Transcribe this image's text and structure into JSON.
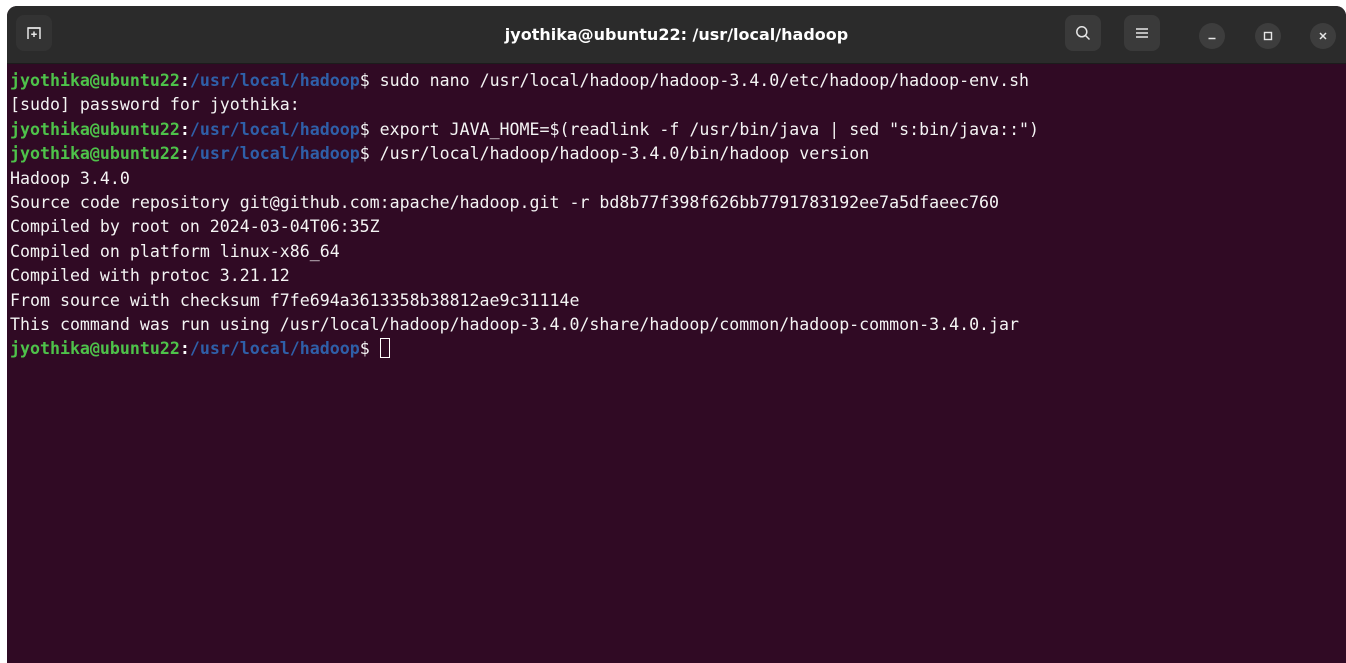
{
  "window": {
    "title": "jyothika@ubuntu22: /usr/local/hadoop"
  },
  "titlebar": {
    "new_tab_icon": "new-tab-icon",
    "search_icon": "search-icon",
    "menu_icon": "hamburger-menu-icon",
    "minimize_icon": "minimize-icon",
    "maximize_icon": "maximize-icon",
    "close_icon": "close-icon"
  },
  "prompt": {
    "user_host": "jyothika@ubuntu22",
    "separator": ":",
    "path": "/usr/local/hadoop",
    "dollar": "$"
  },
  "terminal": {
    "lines": [
      {
        "type": "prompt",
        "command": " sudo nano /usr/local/hadoop/hadoop-3.4.0/etc/hadoop/hadoop-env.sh"
      },
      {
        "type": "output",
        "text": "[sudo] password for jyothika:"
      },
      {
        "type": "prompt",
        "command": " export JAVA_HOME=$(readlink -f /usr/bin/java | sed \"s:bin/java::\")"
      },
      {
        "type": "prompt",
        "command": " /usr/local/hadoop/hadoop-3.4.0/bin/hadoop version"
      },
      {
        "type": "output",
        "text": "Hadoop 3.4.0"
      },
      {
        "type": "output",
        "text": "Source code repository git@github.com:apache/hadoop.git -r bd8b77f398f626bb7791783192ee7a5dfaeec760"
      },
      {
        "type": "output",
        "text": "Compiled by root on 2024-03-04T06:35Z"
      },
      {
        "type": "output",
        "text": "Compiled on platform linux-x86_64"
      },
      {
        "type": "output",
        "text": "Compiled with protoc 3.21.12"
      },
      {
        "type": "output",
        "text": "From source with checksum f7fe694a3613358b38812ae9c31114e"
      },
      {
        "type": "output",
        "text": "This command was run using /usr/local/hadoop/hadoop-3.4.0/share/hadoop/common/hadoop-common-3.4.0.jar"
      },
      {
        "type": "prompt",
        "command": " "
      }
    ]
  },
  "colors": {
    "terminal_bg": "#300a24",
    "titlebar_bg": "#2b2b2b",
    "prompt_user": "#4ec24a",
    "prompt_path": "#2f5fa8",
    "text": "#f4f4f4"
  }
}
